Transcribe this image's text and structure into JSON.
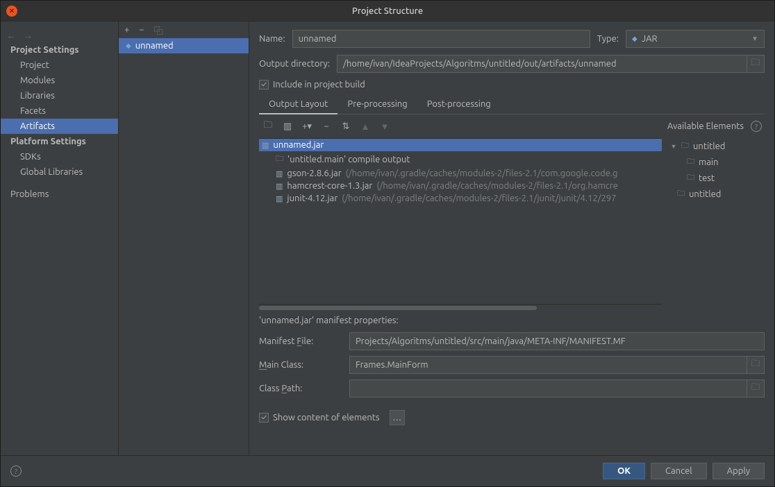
{
  "title": "Project Structure",
  "sidebar": {
    "projectSettings": "Project Settings",
    "items1": [
      "Project",
      "Modules",
      "Libraries",
      "Facets",
      "Artifacts"
    ],
    "platformSettings": "Platform Settings",
    "items2": [
      "SDKs",
      "Global Libraries"
    ],
    "problems": "Problems",
    "selected": "Artifacts"
  },
  "artifactList": {
    "selected": "unnamed"
  },
  "form": {
    "nameLabel": "Name:",
    "name": "unnamed",
    "typeLabel": "Type:",
    "type": "JAR",
    "outputDirLabel": "Output directory:",
    "outputDir": "/home/ivan/IdeaProjects/Algoritms/untitled/out/artifacts/unnamed",
    "includeBuild": "Include in project build"
  },
  "tabs": {
    "outputLayout": "Output Layout",
    "preProcessing": "Pre-processing",
    "postProcessing": "Post-processing",
    "active": "Output Layout"
  },
  "availableElementsLabel": "Available Elements",
  "layoutTree": {
    "root": "unnamed.jar",
    "children": [
      {
        "type": "folder",
        "label": "'untitled.main' compile output",
        "path": ""
      },
      {
        "type": "jar",
        "label": "gson-2.8.6.jar",
        "path": "(/home/ivan/.gradle/caches/modules-2/files-2.1/com.google.code.g"
      },
      {
        "type": "jar",
        "label": "hamcrest-core-1.3.jar",
        "path": "(/home/ivan/.gradle/caches/modules-2/files-2.1/org.hamcre"
      },
      {
        "type": "jar",
        "label": "junit-4.12.jar",
        "path": "(/home/ivan/.gradle/caches/modules-2/files-2.1/junit/junit/4.12/297"
      }
    ]
  },
  "availableTree": {
    "root": "untitled",
    "children": [
      {
        "label": "main"
      },
      {
        "label": "test"
      },
      {
        "label": "untitled"
      }
    ]
  },
  "manifest": {
    "header": "'unnamed.jar' manifest properties:",
    "fileLabel": "Manifest File:",
    "file": "Projects/Algoritms/untitled/src/main/java/META-INF/MANIFEST.MF",
    "mainClassLabel": "Main Class:",
    "mainClass": "Frames.MainForm",
    "classPathLabel": "Class Path:",
    "classPath": ""
  },
  "showContent": "Show content of elements",
  "buttons": {
    "ok": "OK",
    "cancel": "Cancel",
    "apply": "Apply"
  }
}
